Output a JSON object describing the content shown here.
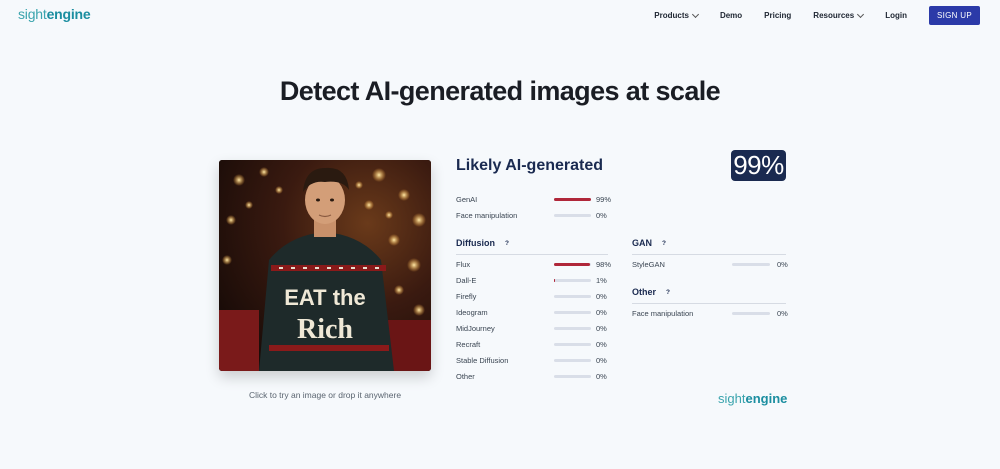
{
  "nav": {
    "logo_part1": "sight",
    "logo_part2": "engine",
    "products": "Products",
    "demo": "Demo",
    "pricing": "Pricing",
    "resources": "Resources",
    "login": "Login",
    "signup": "SIGN UP"
  },
  "hero": {
    "title": "Detect AI-generated images at scale"
  },
  "demo": {
    "caption": "Click to try an image or drop it anywhere",
    "sweater_text_line1": "EAT the",
    "sweater_text_line2": "Rich"
  },
  "result": {
    "title": "Likely AI-generated",
    "score": "99%",
    "summary": [
      {
        "label": "GenAI",
        "value": 0.99,
        "pct": "99%"
      },
      {
        "label": "Face manipulation",
        "value": 0.0,
        "pct": "0%"
      }
    ],
    "diffusion": {
      "title": "Diffusion",
      "help": "?",
      "items": [
        {
          "label": "Flux",
          "value": 0.98,
          "pct": "98%"
        },
        {
          "label": "Dall-E",
          "value": 0.01,
          "pct": "1%"
        },
        {
          "label": "Firefly",
          "value": 0.0,
          "pct": "0%"
        },
        {
          "label": "Ideogram",
          "value": 0.0,
          "pct": "0%"
        },
        {
          "label": "MidJourney",
          "value": 0.0,
          "pct": "0%"
        },
        {
          "label": "Recraft",
          "value": 0.0,
          "pct": "0%"
        },
        {
          "label": "Stable Diffusion",
          "value": 0.0,
          "pct": "0%"
        },
        {
          "label": "Other",
          "value": 0.0,
          "pct": "0%"
        }
      ]
    },
    "gan": {
      "title": "GAN",
      "help": "?",
      "items": [
        {
          "label": "StyleGAN",
          "value": 0.0,
          "pct": "0%"
        }
      ]
    },
    "other": {
      "title": "Other",
      "help": "?",
      "items": [
        {
          "label": "Face manipulation",
          "value": 0.0,
          "pct": "0%"
        }
      ]
    }
  },
  "colors": {
    "accent": "#2b3aa8",
    "navy": "#1a2a50",
    "bar_fill": "#b0273a",
    "bar_track": "#d9dee8",
    "brand_teal": "#1b8ea0"
  }
}
